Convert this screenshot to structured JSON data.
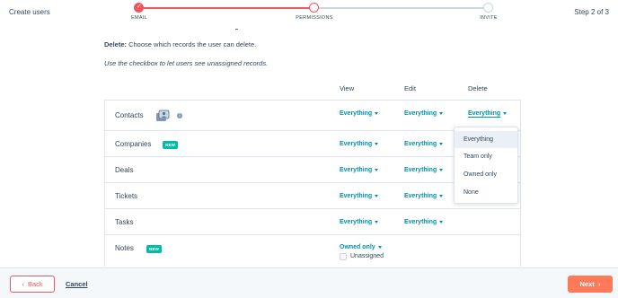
{
  "header": {
    "title": "Create users",
    "step_indicator": "Step 2 of 3",
    "steps": [
      {
        "label": "EMAIL",
        "status": "complete"
      },
      {
        "label": "PERMISSIONS",
        "status": "current"
      },
      {
        "label": "INVITE",
        "status": "upcoming"
      }
    ]
  },
  "intro": {
    "delete_label": "Delete:",
    "delete_text": " Choose which records the user can delete.",
    "checkbox_note": "Use the checkbox to let users see unassigned records."
  },
  "columns": {
    "view": "View",
    "edit": "Edit",
    "delete": "Delete"
  },
  "rows": [
    {
      "label": "Contacts",
      "view": "Everything",
      "edit": "Everything",
      "delete": "Everything",
      "icon": "contacts-icon",
      "info": "i"
    },
    {
      "label": "Companies",
      "badge": "NEW",
      "view": "Everything",
      "edit": "Everything"
    },
    {
      "label": "Deals",
      "view": "Everything",
      "edit": "Everything"
    },
    {
      "label": "Tickets",
      "view": "Everything",
      "edit": "Everything"
    },
    {
      "label": "Tasks",
      "view": "Everything",
      "edit": "Everything"
    },
    {
      "label": "Notes",
      "badge": "NEW",
      "view": "Owned only",
      "checkbox_label": "Unassigned"
    }
  ],
  "delete_menu": {
    "options": [
      "Everything",
      "Team only",
      "Owned only",
      "None"
    ],
    "selected": "Everything"
  },
  "footer": {
    "back_label": "Back",
    "cancel_label": "Cancel",
    "next_label": "Next"
  },
  "colors": {
    "accent": "#f2545b",
    "link": "#0091ae",
    "next_button": "#ff7a59",
    "badge": "#00bda5"
  }
}
